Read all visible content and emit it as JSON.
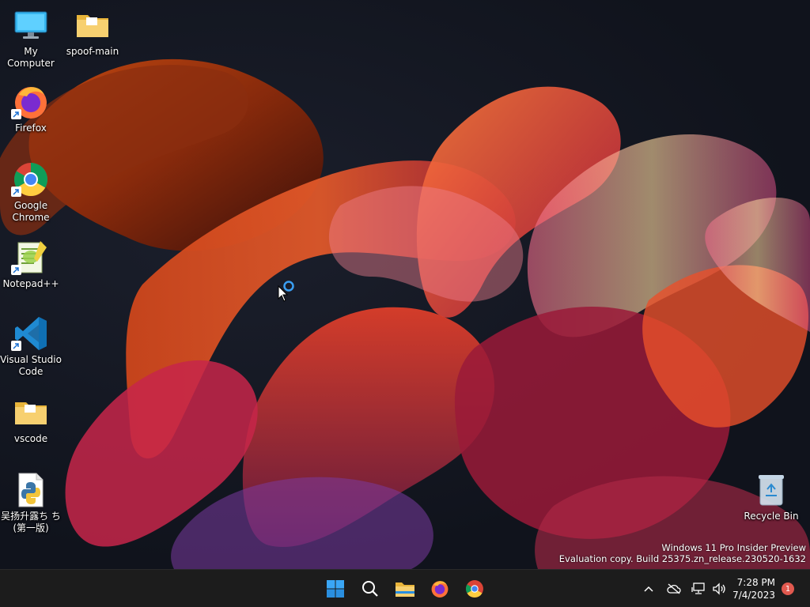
{
  "desktop_icons": [
    {
      "label": "My Computer",
      "icon": "monitor-icon"
    },
    {
      "label": "spoof-main",
      "icon": "folder-icon"
    },
    {
      "label": "Firefox",
      "icon": "firefox-icon"
    },
    {
      "label": "Google Chrome",
      "icon": "chrome-icon"
    },
    {
      "label": "Notepad++",
      "icon": "notepadpp-icon"
    },
    {
      "label": "Visual Studio Code",
      "icon": "vscode-icon"
    },
    {
      "label": "vscode",
      "icon": "folder-icon"
    },
    {
      "label": "吴扬升露ち ち(第一版)",
      "icon": "python-file-icon"
    },
    {
      "label": "Recycle Bin",
      "icon": "recycle-bin-icon"
    }
  ],
  "watermark": {
    "line1": "Windows 11 Pro Insider Preview",
    "line2": "Evaluation copy. Build 25375.zn_release.230520-1632"
  },
  "taskbar": {
    "apps": [
      "start-icon",
      "search-icon",
      "file-explorer-icon",
      "firefox-icon",
      "chrome-icon"
    ],
    "tray_icons": [
      "chevron-up-icon",
      "cloud-off-icon",
      "network-icon",
      "volume-icon"
    ],
    "time": "7:28 PM",
    "date": "7/4/2023",
    "notification_count": "1"
  },
  "colors": {
    "taskbar_bg": "#1c1c1c",
    "accent_blue": "#3a9ff3",
    "badge": "#e1594f"
  }
}
